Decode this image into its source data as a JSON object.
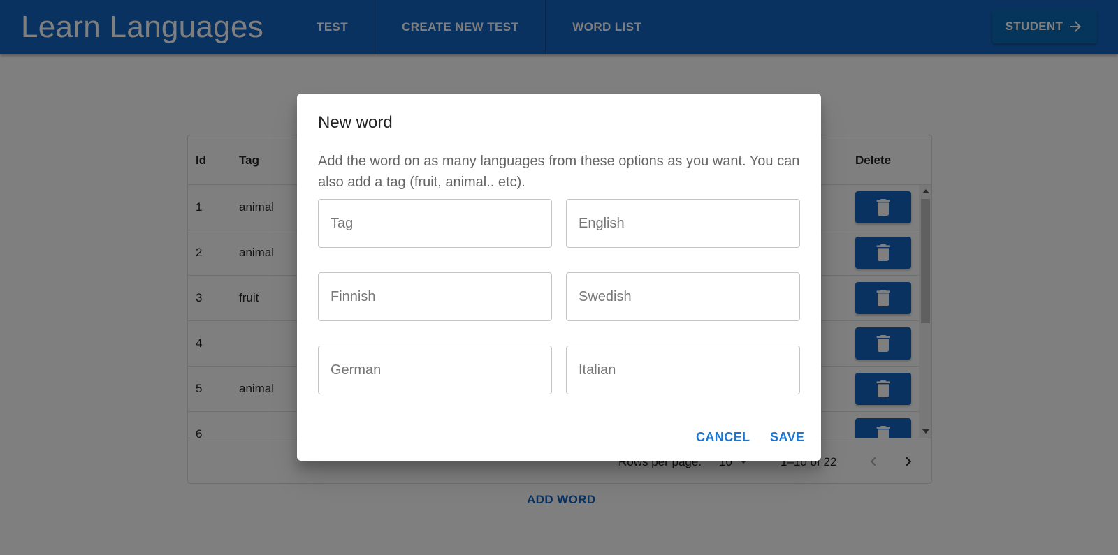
{
  "app": {
    "title": "Learn Languages"
  },
  "nav": [
    {
      "label": "TEST"
    },
    {
      "label": "CREATE NEW TEST"
    },
    {
      "label": "WORD LIST"
    }
  ],
  "user_button": {
    "label": "STUDENT",
    "icon": "arrow-right-icon"
  },
  "table": {
    "headers": {
      "id": "Id",
      "tag": "Tag",
      "delete": "Delete"
    },
    "rows": [
      {
        "id": "1",
        "tag": "animal"
      },
      {
        "id": "2",
        "tag": "animal"
      },
      {
        "id": "3",
        "tag": "fruit"
      },
      {
        "id": "4",
        "tag": ""
      },
      {
        "id": "5",
        "tag": "animal"
      },
      {
        "id": "6",
        "tag": ""
      }
    ],
    "pagination": {
      "rows_per_page_label": "Rows per page:",
      "rows_per_page": "10",
      "range": "1–10 of 22"
    }
  },
  "add_word_label": "ADD WORD",
  "dialog": {
    "title": "New word",
    "description": "Add the word on as many languages from these options as you want. You can also add a tag (fruit, animal.. etc).",
    "fields": {
      "tag": {
        "placeholder": "Tag",
        "value": ""
      },
      "english": {
        "placeholder": "English",
        "value": ""
      },
      "finnish": {
        "placeholder": "Finnish",
        "value": ""
      },
      "swedish": {
        "placeholder": "Swedish",
        "value": ""
      },
      "german": {
        "placeholder": "German",
        "value": ""
      },
      "italian": {
        "placeholder": "Italian",
        "value": ""
      }
    },
    "cancel_label": "CANCEL",
    "save_label": "SAVE"
  },
  "colors": {
    "primary": "#1565c0",
    "accent": "#1976d2"
  }
}
